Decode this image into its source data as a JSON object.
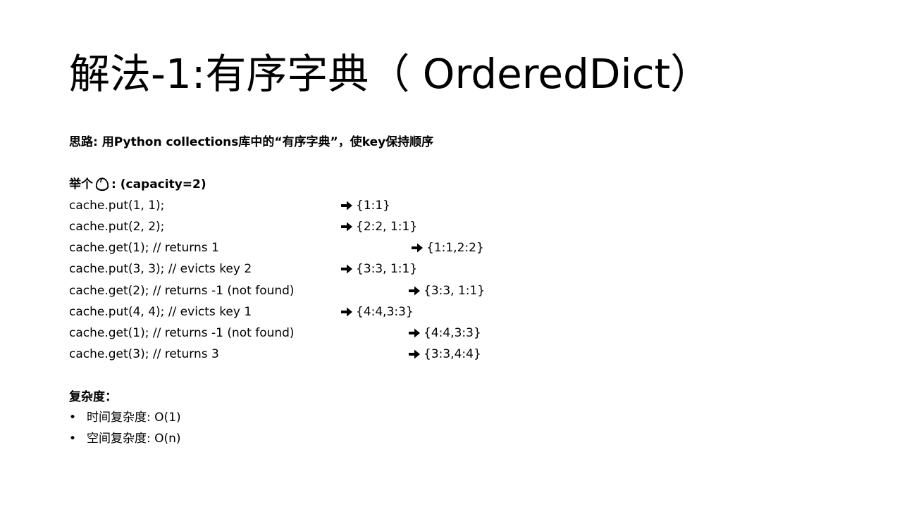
{
  "slide": {
    "title": "解法-1:有序字典（ OrderedDict）",
    "idea": "思路: 用Python collections库中的“有序字典”，使key保持顺序",
    "example": {
      "label_prefix": "举个",
      "icon": "chestnut-icon",
      "label_suffix": ": (capacity=2)",
      "lines": [
        {
          "code": "cache.put(1, 1);",
          "result": "{1:1}"
        },
        {
          "code": "cache.put(2, 2);",
          "result": "{2:2, 1:1}"
        },
        {
          "code": "cache.get(1); // returns 1",
          "result": "{1:1,2:2}"
        },
        {
          "code": "cache.put(3, 3); // evicts key 2",
          "result": "{3:3, 1:1}"
        },
        {
          "code": "cache.get(2); // returns -1 (not found)",
          "result": "{3:3, 1:1}"
        },
        {
          "code": "cache.put(4, 4); // evicts key 1",
          "result": "{4:4,3:3}"
        },
        {
          "code": "cache.get(1); // returns -1 (not found)",
          "result": "{4:4,3:3}"
        },
        {
          "code": "cache.get(3); // returns 3",
          "result": "{3:3,4:4}"
        }
      ],
      "arrow_icon": "right-arrow-icon"
    },
    "complexity": {
      "heading": "复杂度：",
      "bullet_glyph": "•",
      "items": [
        "时间复杂度: O(1)",
        "空间复杂度: O(n)"
      ]
    },
    "colors": {
      "text": "#000000",
      "background": "#ffffff"
    }
  }
}
